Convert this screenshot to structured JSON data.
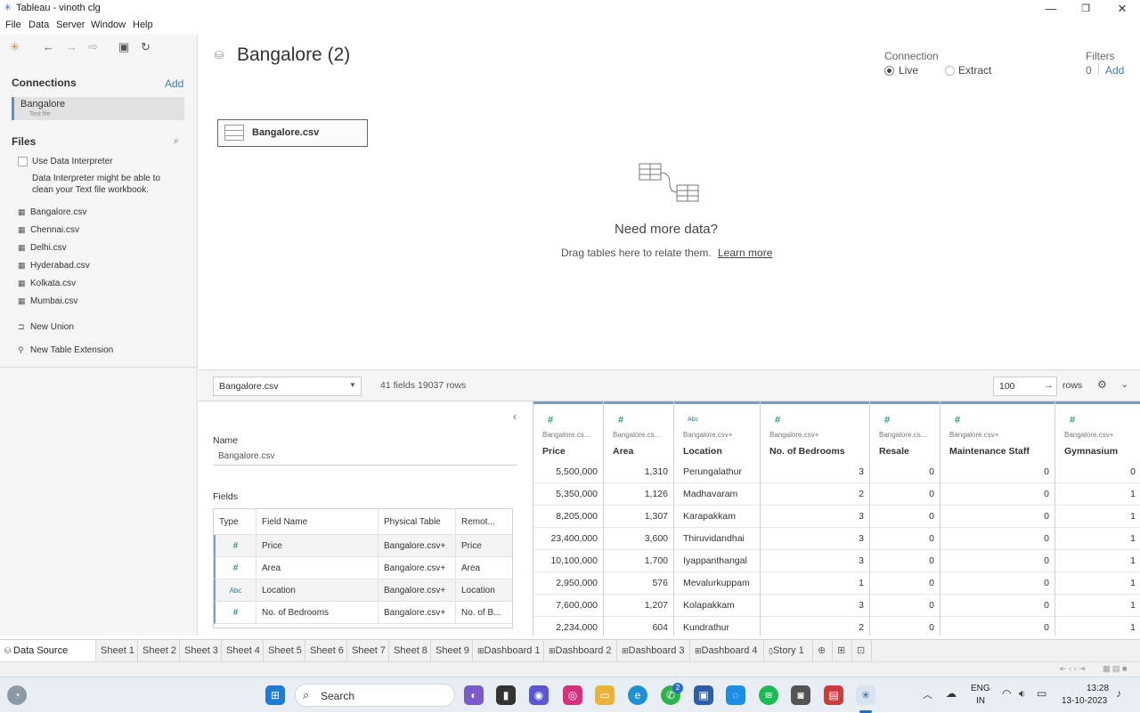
{
  "window": {
    "title": "Tableau - vinoth clg"
  },
  "menu": [
    "File",
    "Data",
    "Server",
    "Window",
    "Help"
  ],
  "connections": {
    "title": "Connections",
    "add_label": "Add",
    "item_name": "Bangalore",
    "item_sub": "Text file"
  },
  "files": {
    "title": "Files",
    "interpreter_label": "Use Data Interpreter",
    "interpreter_note_1": "Data Interpreter might be able to",
    "interpreter_note_2": "clean your Text file workbook.",
    "list": [
      "Bangalore.csv",
      "Chennai.csv",
      "Delhi.csv",
      "Hyderabad.csv",
      "Kolkata.csv",
      "Mumbai.csv"
    ],
    "new_union": "New Union",
    "new_table_ext": "New Table Extension"
  },
  "canvas": {
    "datasource_title": "Bangalore (2)",
    "connection_label": "Connection",
    "live_label": "Live",
    "extract_label": "Extract",
    "filters_label": "Filters",
    "filters_count": "0",
    "filters_add": "Add",
    "table_chip": "Bangalore.csv",
    "need_more": "Need more data?",
    "drag_text": "Drag tables here to relate them.",
    "learn_more": "Learn more"
  },
  "gridbar": {
    "table_select": "Bangalore.csv",
    "summary": "41 fields 19037 rows",
    "rows_value": "100",
    "rows_label": "rows"
  },
  "meta": {
    "name_label": "Name",
    "name_value": "Bangalore.csv",
    "fields_label": "Fields",
    "headers": [
      "Type",
      "Field Name",
      "Physical Table",
      "Remot..."
    ],
    "rows": [
      {
        "type": "#",
        "name": "Price",
        "table": "Bangalore.csv+",
        "remote": "Price"
      },
      {
        "type": "#",
        "name": "Area",
        "table": "Bangalore.csv+",
        "remote": "Area"
      },
      {
        "type": "Abc",
        "name": "Location",
        "table": "Bangalore.csv+",
        "remote": "Location"
      },
      {
        "type": "#",
        "name": "No. of Bedrooms",
        "table": "Bangalore.csv+",
        "remote": "No. of B..."
      }
    ]
  },
  "grid": {
    "columns": [
      {
        "type": "#",
        "src": "Bangalore.cs...",
        "name": "Price"
      },
      {
        "type": "#",
        "src": "Bangalore.cs...",
        "name": "Area"
      },
      {
        "type": "Abc",
        "src": "Bangalore.csv+",
        "name": "Location"
      },
      {
        "type": "#",
        "src": "Bangalore.csv+",
        "name": "No. of Bedrooms"
      },
      {
        "type": "#",
        "src": "Bangalore.cs...",
        "name": "Resale"
      },
      {
        "type": "#",
        "src": "Bangalore.csv+",
        "name": "Maintenance Staff"
      },
      {
        "type": "#",
        "src": "Bangalore.csv+",
        "name": "Gymnasium"
      }
    ],
    "rows": [
      [
        "5,500,000",
        "1,310",
        "Perungalathur",
        "3",
        "0",
        "0",
        "0"
      ],
      [
        "5,350,000",
        "1,126",
        "Madhavaram",
        "2",
        "0",
        "0",
        "1"
      ],
      [
        "8,205,000",
        "1,307",
        "Karapakkam",
        "3",
        "0",
        "0",
        "1"
      ],
      [
        "23,400,000",
        "3,600",
        "Thiruvidandhai",
        "3",
        "0",
        "0",
        "1"
      ],
      [
        "10,100,000",
        "1,700",
        "Iyappanthangal",
        "3",
        "0",
        "0",
        "1"
      ],
      [
        "2,950,000",
        "576",
        "Mevalurkuppam",
        "1",
        "0",
        "0",
        "1"
      ],
      [
        "7,600,000",
        "1,207",
        "Kolapakkam",
        "3",
        "0",
        "0",
        "1"
      ],
      [
        "2,234,000",
        "604",
        "Kundrathur",
        "2",
        "0",
        "0",
        "1"
      ]
    ]
  },
  "tabs": [
    "Data Source",
    "Sheet 1",
    "Sheet 2",
    "Sheet 3",
    "Sheet 4",
    "Sheet 5",
    "Sheet 6",
    "Sheet 7",
    "Sheet 8",
    "Sheet 9",
    "Dashboard 1",
    "Dashboard 2",
    "Dashboard 3",
    "Dashboard 4",
    "Story 1"
  ],
  "taskbar": {
    "search_placeholder": "Search",
    "lang_1": "ENG",
    "lang_2": "IN",
    "time": "13:28",
    "date": "13-10-2023",
    "whatsapp_badge": "2"
  },
  "colors": {
    "accent": "#3f7ab6",
    "header_strip": "#7e9cc4",
    "measure_green": "#2a9a7a"
  }
}
